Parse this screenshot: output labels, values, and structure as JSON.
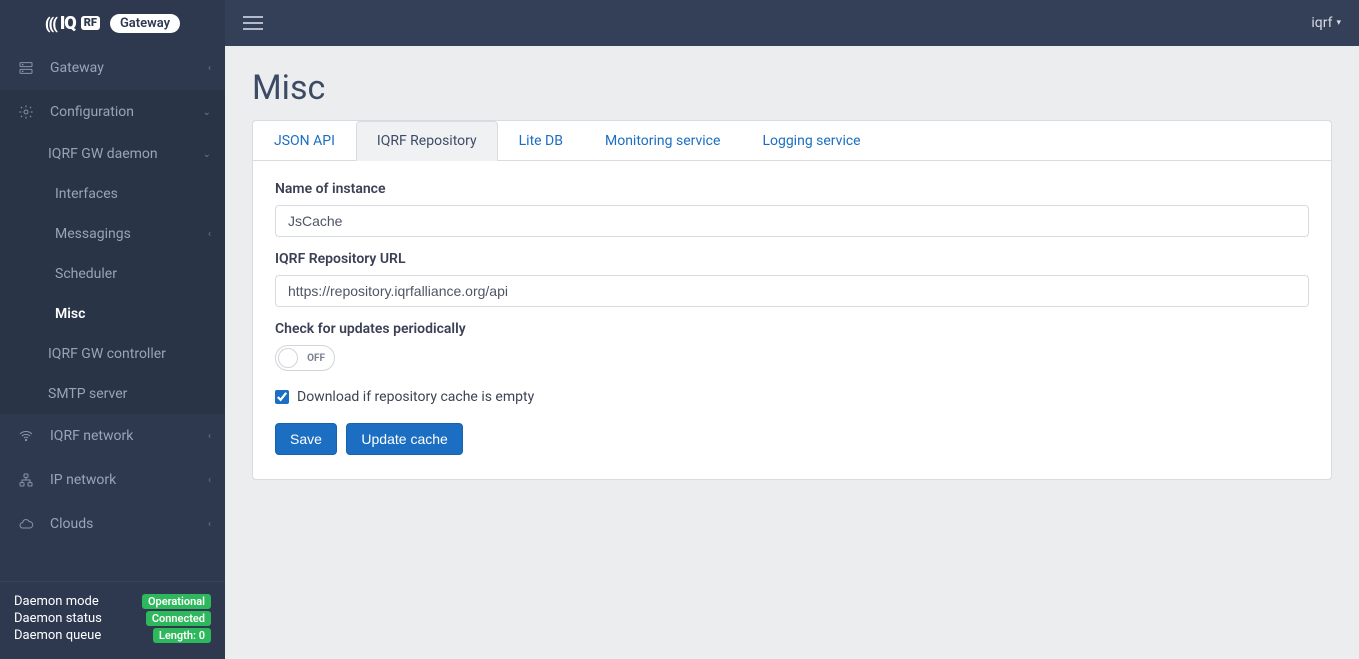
{
  "brand": {
    "name": "IQRF",
    "product": "Gateway"
  },
  "topbar": {
    "user": "iqrf"
  },
  "sidebar": {
    "items": [
      {
        "label": "Gateway",
        "icon": "server"
      },
      {
        "label": "Configuration",
        "icon": "gear"
      },
      {
        "label": "IQRF GW daemon"
      },
      {
        "label": "Interfaces"
      },
      {
        "label": "Messagings"
      },
      {
        "label": "Scheduler"
      },
      {
        "label": "Misc"
      },
      {
        "label": "IQRF GW controller"
      },
      {
        "label": "SMTP server"
      },
      {
        "label": "IQRF network",
        "icon": "wifi"
      },
      {
        "label": "IP network",
        "icon": "network"
      },
      {
        "label": "Clouds",
        "icon": "cloud"
      }
    ]
  },
  "footer": {
    "rows": [
      {
        "label": "Daemon mode",
        "badge": "Operational"
      },
      {
        "label": "Daemon status",
        "badge": "Connected"
      },
      {
        "label": "Daemon queue",
        "badge": "Length: 0"
      }
    ]
  },
  "page": {
    "title": "Misc",
    "tabs": [
      {
        "label": "JSON API",
        "active": false
      },
      {
        "label": "IQRF Repository",
        "active": true
      },
      {
        "label": "Lite DB",
        "active": false
      },
      {
        "label": "Monitoring service",
        "active": false
      },
      {
        "label": "Logging service",
        "active": false
      }
    ],
    "form": {
      "instance_label": "Name of instance",
      "instance_value": "JsCache",
      "repo_url_label": "IQRF Repository URL",
      "repo_url_value": "https://repository.iqrfalliance.org/api",
      "periodic_label": "Check for updates periodically",
      "periodic_toggle_text": "OFF",
      "download_empty_label": "Download if repository cache is empty",
      "download_empty_checked": true,
      "save_label": "Save",
      "update_label": "Update cache"
    }
  }
}
